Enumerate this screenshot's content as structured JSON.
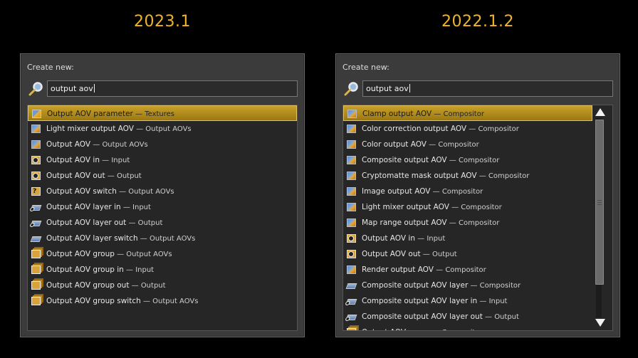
{
  "left": {
    "version": "2023.1",
    "create_label": "Create new:",
    "search_value": "output aov",
    "items": [
      {
        "name": "Output AOV parameter",
        "category": "Textures",
        "icon": "texture-icon",
        "selected": true
      },
      {
        "name": "Light mixer output AOV",
        "category": "Output AOVs",
        "icon": "aov-icon"
      },
      {
        "name": "Output AOV",
        "category": "Output AOVs",
        "icon": "aov-icon"
      },
      {
        "name": "Output AOV in",
        "category": "Input",
        "icon": "input-node-icon"
      },
      {
        "name": "Output AOV out",
        "category": "Output",
        "icon": "output-node-icon"
      },
      {
        "name": "Output AOV switch",
        "category": "Output AOVs",
        "icon": "switch-icon"
      },
      {
        "name": "Output AOV layer in",
        "category": "Input",
        "icon": "layer-input-icon"
      },
      {
        "name": "Output AOV layer out",
        "category": "Output",
        "icon": "layer-output-icon"
      },
      {
        "name": "Output AOV layer switch",
        "category": "Output AOVs",
        "icon": "layer-switch-icon"
      },
      {
        "name": "Output AOV group",
        "category": "Output AOVs",
        "icon": "group-icon"
      },
      {
        "name": "Output AOV group in",
        "category": "Input",
        "icon": "group-input-icon"
      },
      {
        "name": "Output AOV group out",
        "category": "Output",
        "icon": "group-output-icon"
      },
      {
        "name": "Output AOV group switch",
        "category": "Output AOVs",
        "icon": "group-switch-icon"
      }
    ]
  },
  "right": {
    "version": "2022.1.2",
    "create_label": "Create new:",
    "search_value": "output aov",
    "items": [
      {
        "name": "Clamp output AOV",
        "category": "Compositor",
        "icon": "aov-icon",
        "selected": true
      },
      {
        "name": "Color correction output AOV",
        "category": "Compositor",
        "icon": "aov-icon"
      },
      {
        "name": "Color output AOV",
        "category": "Compositor",
        "icon": "aov-icon"
      },
      {
        "name": "Composite output AOV",
        "category": "Compositor",
        "icon": "aov-icon"
      },
      {
        "name": "Cryptomatte mask output AOV",
        "category": "Compositor",
        "icon": "aov-icon"
      },
      {
        "name": "Image output AOV",
        "category": "Compositor",
        "icon": "aov-icon"
      },
      {
        "name": "Light mixer output AOV",
        "category": "Compositor",
        "icon": "aov-icon"
      },
      {
        "name": "Map range output AOV",
        "category": "Compositor",
        "icon": "aov-icon"
      },
      {
        "name": "Output AOV in",
        "category": "Input",
        "icon": "input-node-icon"
      },
      {
        "name": "Output AOV out",
        "category": "Output",
        "icon": "output-node-icon"
      },
      {
        "name": "Render output AOV",
        "category": "Compositor",
        "icon": "aov-icon"
      },
      {
        "name": "Composite output AOV layer",
        "category": "Compositor",
        "icon": "layer-icon"
      },
      {
        "name": "Composite output AOV layer in",
        "category": "Input",
        "icon": "layer-input-icon"
      },
      {
        "name": "Composite output AOV layer out",
        "category": "Output",
        "icon": "layer-output-icon"
      },
      {
        "name": "Output AOV group",
        "category": "Compositor",
        "icon": "group-icon"
      }
    ]
  },
  "separator": " — ",
  "colors": {
    "title": "#f0b429",
    "selection": "#b8911f",
    "panel": "#3b3b3b",
    "list": "#262626"
  }
}
